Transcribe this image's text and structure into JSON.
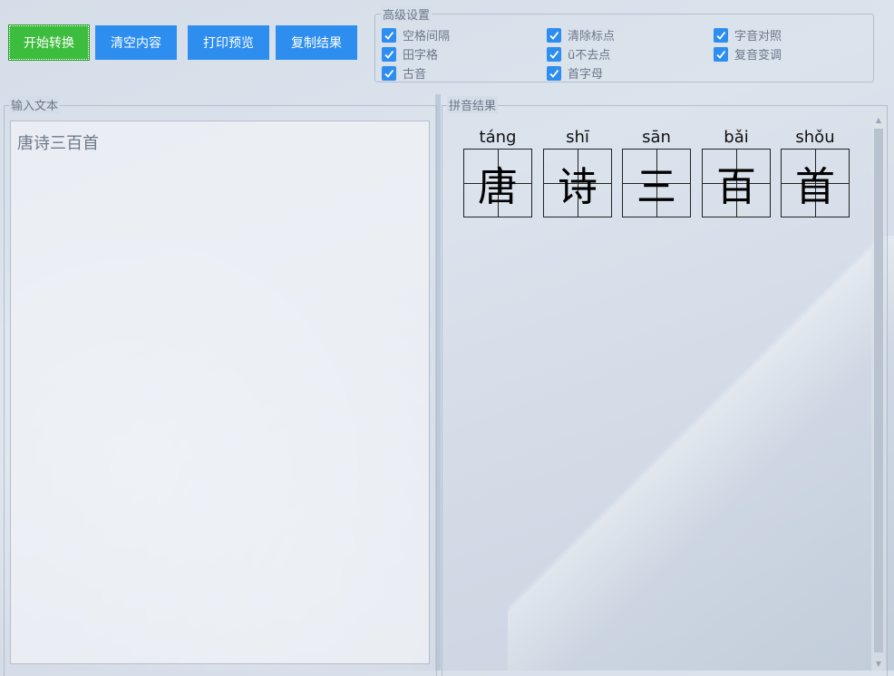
{
  "toolbar": {
    "convert": "开始转换",
    "clear": "清空内容",
    "print_preview": "打印预览",
    "copy": "复制结果"
  },
  "settings": {
    "title": "高级设置",
    "options": [
      {
        "label": "空格间隔",
        "checked": true
      },
      {
        "label": "清除标点",
        "checked": true
      },
      {
        "label": "字音对照",
        "checked": true
      },
      {
        "label": "田字格",
        "checked": true
      },
      {
        "label": "ü不去点",
        "checked": true
      },
      {
        "label": "复音变调",
        "checked": true
      },
      {
        "label": "古音",
        "checked": true
      },
      {
        "label": "首字母",
        "checked": true
      }
    ]
  },
  "input": {
    "title": "输入文本",
    "value": "唐诗三百首"
  },
  "result": {
    "title": "拼音结果",
    "items": [
      {
        "pinyin": "táng",
        "char": "唐"
      },
      {
        "pinyin": "shī",
        "char": "诗"
      },
      {
        "pinyin": "sān",
        "char": "三"
      },
      {
        "pinyin": "bǎi",
        "char": "百"
      },
      {
        "pinyin": "shǒu",
        "char": "首"
      }
    ]
  },
  "colors": {
    "primary_button": "#3dbd3d",
    "button": "#2e8ef0",
    "checkbox": "#2e8ef0"
  }
}
